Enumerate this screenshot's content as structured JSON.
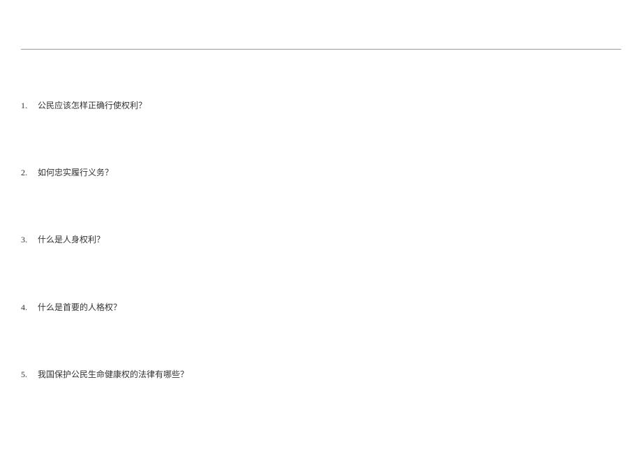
{
  "questions": [
    {
      "number": "1.",
      "text": "公民应该怎样正确行使权利？"
    },
    {
      "number": "2.",
      "text": "如何忠实履行义务？"
    },
    {
      "number": "3.",
      "text": "什么是人身权利？"
    },
    {
      "number": "4.",
      "text": "什么是首要的人格权？"
    },
    {
      "number": "5.",
      "text": "我国保护公民生命健康权的法律有哪些？"
    }
  ]
}
